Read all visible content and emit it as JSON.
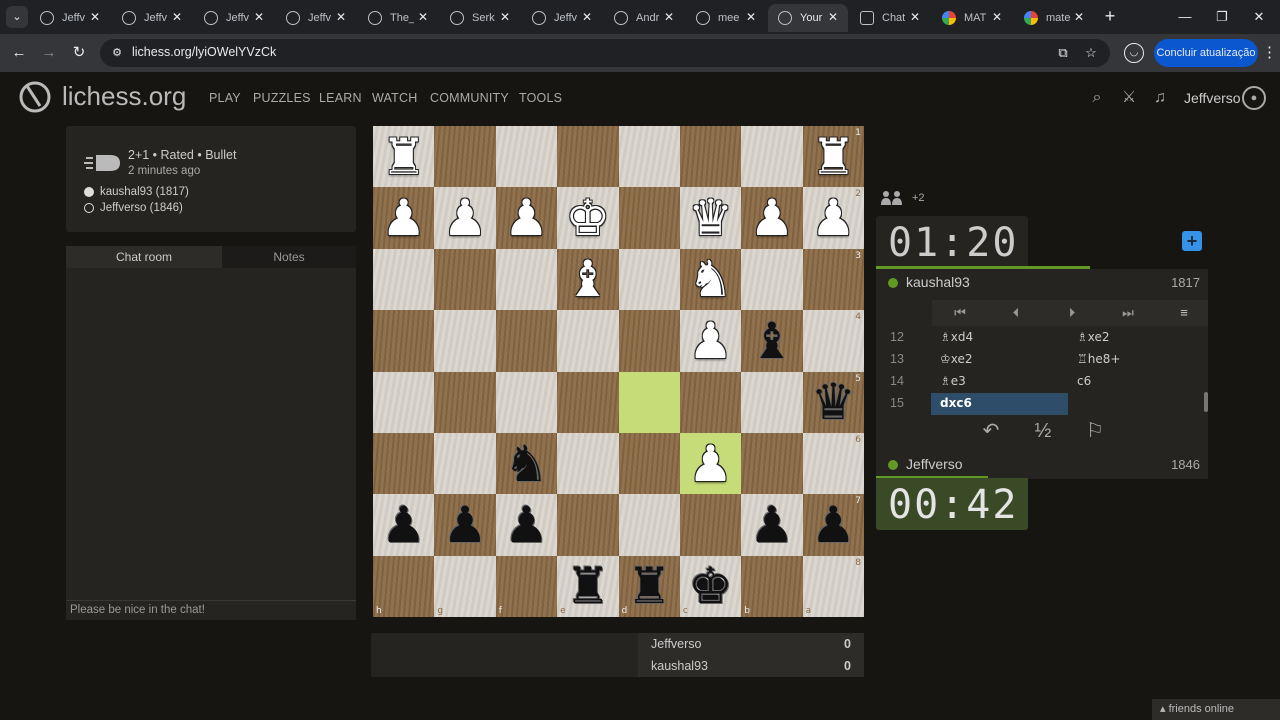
{
  "browser": {
    "tab_menu_icon": "chevron-down-icon",
    "tabs": [
      {
        "label": "Jeffv",
        "favicon": "lichess"
      },
      {
        "label": "Jeffv",
        "favicon": "lichess"
      },
      {
        "label": "Jeffv",
        "favicon": "lichess"
      },
      {
        "label": "Jeffv",
        "favicon": "lichess"
      },
      {
        "label": "The_",
        "favicon": "lichess"
      },
      {
        "label": "Serk",
        "favicon": "lichess"
      },
      {
        "label": "Jeffv",
        "favicon": "lichess"
      },
      {
        "label": "Andr",
        "favicon": "lichess"
      },
      {
        "label": "mee",
        "favicon": "lichess"
      },
      {
        "label": "Your",
        "favicon": "lichess",
        "active": true
      },
      {
        "label": "Chat",
        "favicon": "chat"
      },
      {
        "label": "MAT",
        "favicon": "google"
      },
      {
        "label": "mate",
        "favicon": "google"
      }
    ],
    "url": "lichess.org/lyiOWelYVzCk",
    "update_button": "Concluir atualização"
  },
  "header": {
    "logo": "lichess.org",
    "nav": [
      "PLAY",
      "PUZZLES",
      "LEARN",
      "WATCH",
      "COMMUNITY",
      "TOOLS"
    ],
    "username": "Jeffverso"
  },
  "game_info": {
    "setup": "2+1 • Rated • Bullet",
    "time_ago": "2 minutes ago",
    "white_player": "kaushal93 (1817)",
    "black_player": "Jeffverso (1846)"
  },
  "chat": {
    "tab_chat": "Chat room",
    "tab_notes": "Notes",
    "placeholder": "Please be nice in the chat!"
  },
  "board": {
    "orientation": "black",
    "colors": {
      "light": "#d9d4cc",
      "dark": "#8b6a46",
      "highlight": "#a7c84f"
    },
    "ranks": [
      "1",
      "2",
      "3",
      "4",
      "5",
      "6",
      "7",
      "8"
    ],
    "files": [
      "h",
      "g",
      "f",
      "e",
      "d",
      "c",
      "b",
      "a"
    ],
    "pieces": [
      [
        "wR",
        "",
        "",
        "",
        "",
        "",
        "",
        "wR"
      ],
      [
        "wP",
        "wP",
        "wP",
        "wK",
        "",
        "wQ",
        "wP",
        "wP"
      ],
      [
        "",
        "",
        "",
        "wB",
        "",
        "wN",
        "",
        ""
      ],
      [
        "",
        "",
        "",
        "",
        "",
        "wP",
        "bB",
        ""
      ],
      [
        "",
        "",
        "",
        "",
        "",
        "",
        "",
        "bQ"
      ],
      [
        "",
        "",
        "bN",
        "",
        "",
        "wP",
        "",
        ""
      ],
      [
        "bP",
        "bP",
        "bP",
        "",
        "",
        "",
        "bP",
        "bP"
      ],
      [
        "",
        "",
        "",
        "bR",
        "bR",
        "bK",
        "",
        ""
      ]
    ],
    "highlights": [
      [
        4,
        4
      ],
      [
        5,
        5
      ]
    ]
  },
  "score": [
    {
      "name": "Jeffverso",
      "score": "0"
    },
    {
      "name": "kaushal93",
      "score": "0"
    }
  ],
  "right": {
    "spectators": "+2",
    "opponent": {
      "name": "kaushal93",
      "rating": "1817",
      "clock": "01:20"
    },
    "me": {
      "name": "Jeffverso",
      "rating": "1846",
      "clock": "00:42"
    },
    "moves": [
      {
        "no": "12",
        "white": "♗xd4",
        "black": "♗xe2"
      },
      {
        "no": "13",
        "white": "♔xe2",
        "black": "♖he8+"
      },
      {
        "no": "14",
        "white": "♗e3",
        "black": "c6"
      },
      {
        "no": "15",
        "white": "dxc6",
        "black": ""
      }
    ],
    "draw_label": "½"
  },
  "footer": {
    "friends": "friends online"
  }
}
